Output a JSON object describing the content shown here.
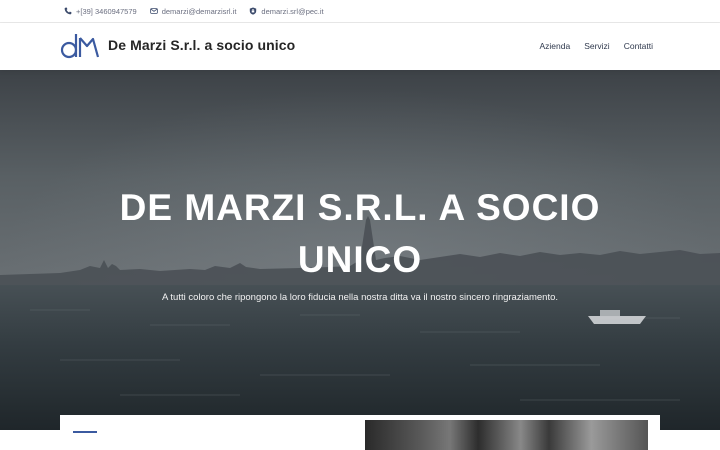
{
  "topbar": {
    "phone": "+[39] 3460947579",
    "email": "demarzi@demarzisrl.it",
    "pec": "demarzi.srl@pec.it"
  },
  "header": {
    "brand": "De Marzi S.r.l. a socio unico",
    "logo_letters": "dm",
    "nav": [
      {
        "label": "Azienda"
      },
      {
        "label": "Servizi"
      },
      {
        "label": "Contatti"
      }
    ]
  },
  "hero": {
    "title_line1": "DE MARZI S.R.L. A SOCIO",
    "title_line2": "UNICO",
    "subtitle": "A tutti coloro che ripongono la loro fiducia nella nostra ditta va il nostro sincero ringraziamento."
  },
  "colors": {
    "brand_blue": "#3b5aa0",
    "text_dark": "#262626",
    "muted": "#6b6f80"
  },
  "icons": {
    "phone": "phone-icon",
    "email": "envelope-icon",
    "pec": "shield-icon"
  }
}
